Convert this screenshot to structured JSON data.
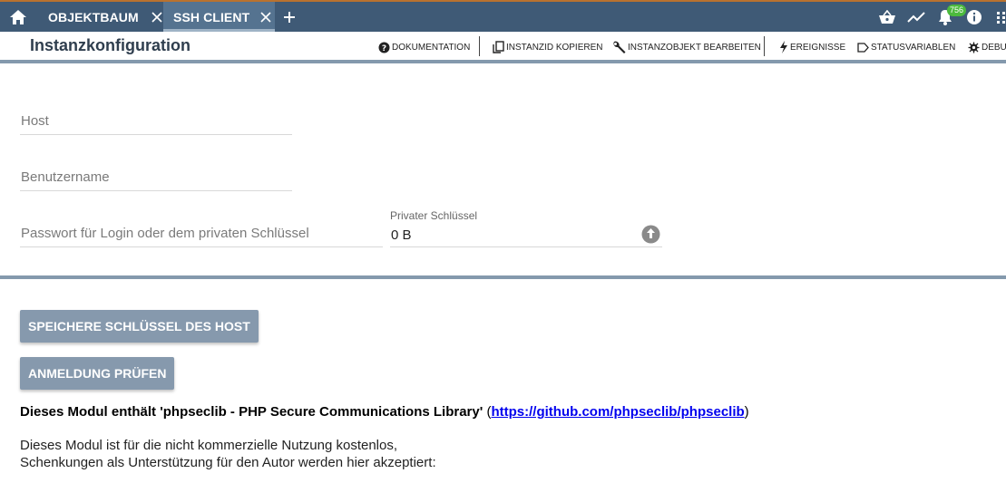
{
  "tabs": [
    {
      "label": "OBJEKTBAUM"
    },
    {
      "label": "SSH CLIENT"
    }
  ],
  "header": {
    "title": "Instanzkonfiguration",
    "notifications_count": "756",
    "actions": [
      {
        "label": "DOKUMENTATION",
        "icon": "help-circle-icon"
      },
      {
        "label": "INSTANZID KOPIEREN",
        "icon": "copy-icon"
      },
      {
        "label": "INSTANZOBJEKT BEARBEITEN",
        "icon": "wrench-icon"
      },
      {
        "label": "EREIGNISSE",
        "icon": "lightning-icon"
      },
      {
        "label": "STATUSVARIABLEN",
        "icon": "tag-icon"
      },
      {
        "label": "DEBUG",
        "icon": "bug-icon"
      }
    ]
  },
  "form": {
    "host_placeholder": "Host",
    "username_placeholder": "Benutzername",
    "password_placeholder": "Passwort für Login oder dem privaten Schlüssel",
    "private_key_label": "Privater Schlüssel",
    "private_key_value": "0 B"
  },
  "buttons": {
    "save_host_key": "SPEICHERE SCHLÜSSEL DES HOST",
    "check_login": "ANMELDUNG PRÜFEN"
  },
  "info": {
    "module_text": "Dieses Modul enthält 'phpseclib - PHP Secure Communications Library'",
    "paren_open": " (",
    "link": "https://github.com/phpseclib/phpseclib",
    "paren_close": ")",
    "line1": "Dieses Modul ist für die nicht kommerzielle Nutzung kostenlos,",
    "line2": "Schenkungen als Unterstützung für den Autor werden hier akzeptiert:"
  },
  "colors": {
    "topbar": "#3f5a76",
    "active_tab": "#557390",
    "button": "#8699ad",
    "badge": "#4cba3d"
  }
}
